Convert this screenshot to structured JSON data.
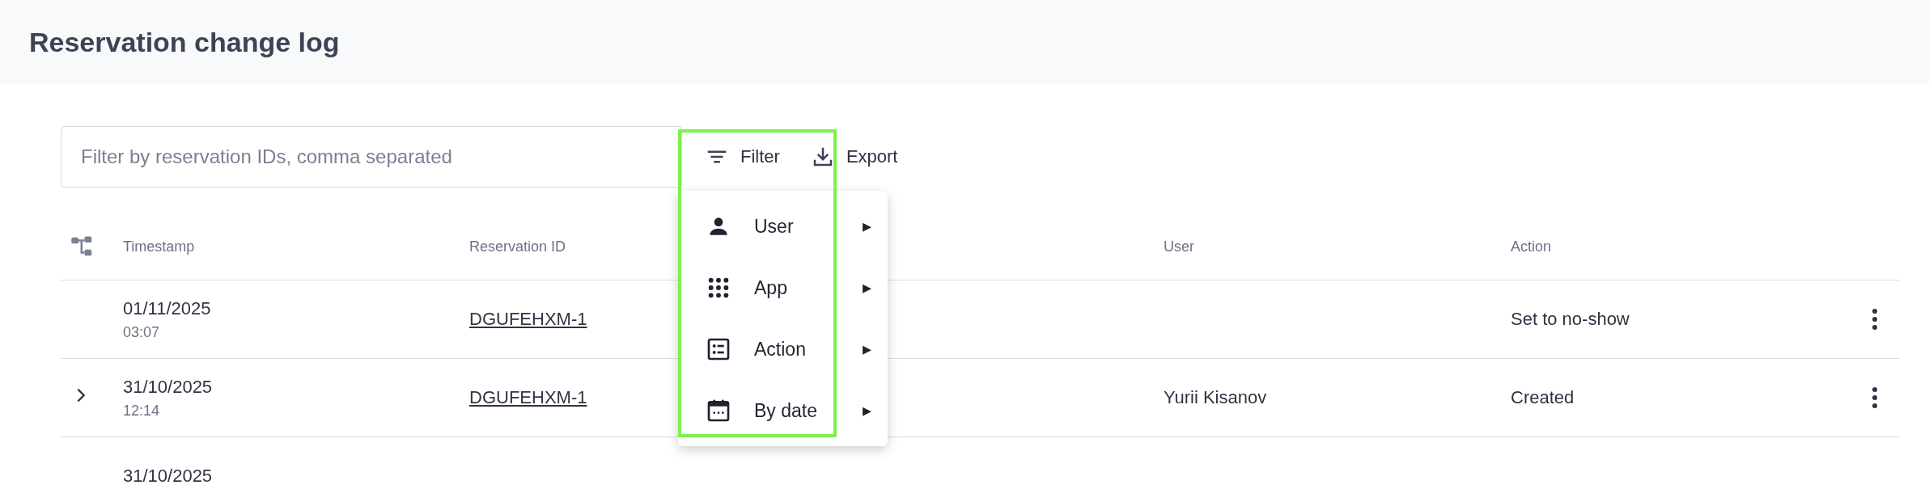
{
  "page": {
    "title": "Reservation change log"
  },
  "toolbar": {
    "search": {
      "placeholder": "Filter by reservation IDs, comma separated"
    },
    "filter_button": "Filter",
    "export_button": "Export"
  },
  "filter_menu": {
    "items": [
      {
        "kind": "user",
        "label": "User",
        "submenu": "▸"
      },
      {
        "kind": "app",
        "label": "App",
        "submenu": "▸"
      },
      {
        "kind": "action",
        "label": "Action",
        "submenu": "▸"
      },
      {
        "kind": "date",
        "label": "By date",
        "submenu": "▸"
      }
    ]
  },
  "table": {
    "columns": [
      "Timestamp",
      "Reservation ID",
      "User",
      "Action"
    ],
    "rows": [
      {
        "expandable": false,
        "date": "01/11/2025",
        "time": "03:07",
        "reservation_id": "DGUFEHXM-1",
        "user": "",
        "action": "Set to no-show"
      },
      {
        "expandable": true,
        "date": "31/10/2025",
        "time": "12:14",
        "reservation_id": "DGUFEHXM-1",
        "user": "Yurii Kisanov",
        "action": "Created"
      },
      {
        "expandable": false,
        "date": "31/10/2025",
        "time": "",
        "reservation_id": "",
        "user": "",
        "action": ""
      }
    ]
  }
}
